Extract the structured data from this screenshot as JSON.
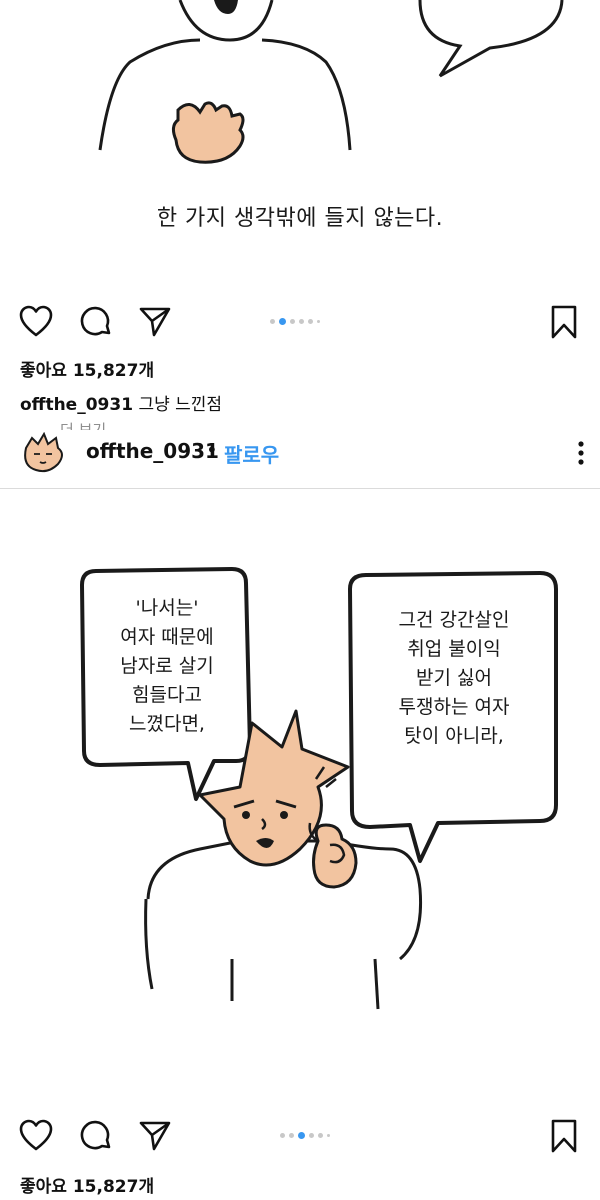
{
  "post1": {
    "caption_panel_text": "한 가지 생각밖에 들지 않는다.",
    "likes": "좋아요 15,827개",
    "caption_user": "offthe_0931",
    "caption_text": "그냥 느낀점",
    "more_label": "더 보기",
    "carousel_active_index": 2
  },
  "post2": {
    "header": {
      "username": "offthe_0931",
      "separator": "•",
      "follow_label": "팔로우"
    },
    "bubble_left": [
      "'나서는'",
      "여자 때문에",
      "남자로 살기",
      "힘들다고",
      "느꼈다면,"
    ],
    "bubble_right": [
      "그건 강간살인",
      "취업 불이익",
      "받기 싫어",
      "투쟁하는 여자",
      "탓이 아니라,"
    ],
    "likes": "좋아요 15,827개",
    "carousel_active_index": 3
  },
  "icons": [
    "heart-icon",
    "comment-icon",
    "share-icon",
    "bookmark-icon",
    "more-options-icon"
  ],
  "colors": {
    "accent": "#3897f0",
    "skin": "#f2c4a0",
    "ink": "#1a1a1a"
  }
}
